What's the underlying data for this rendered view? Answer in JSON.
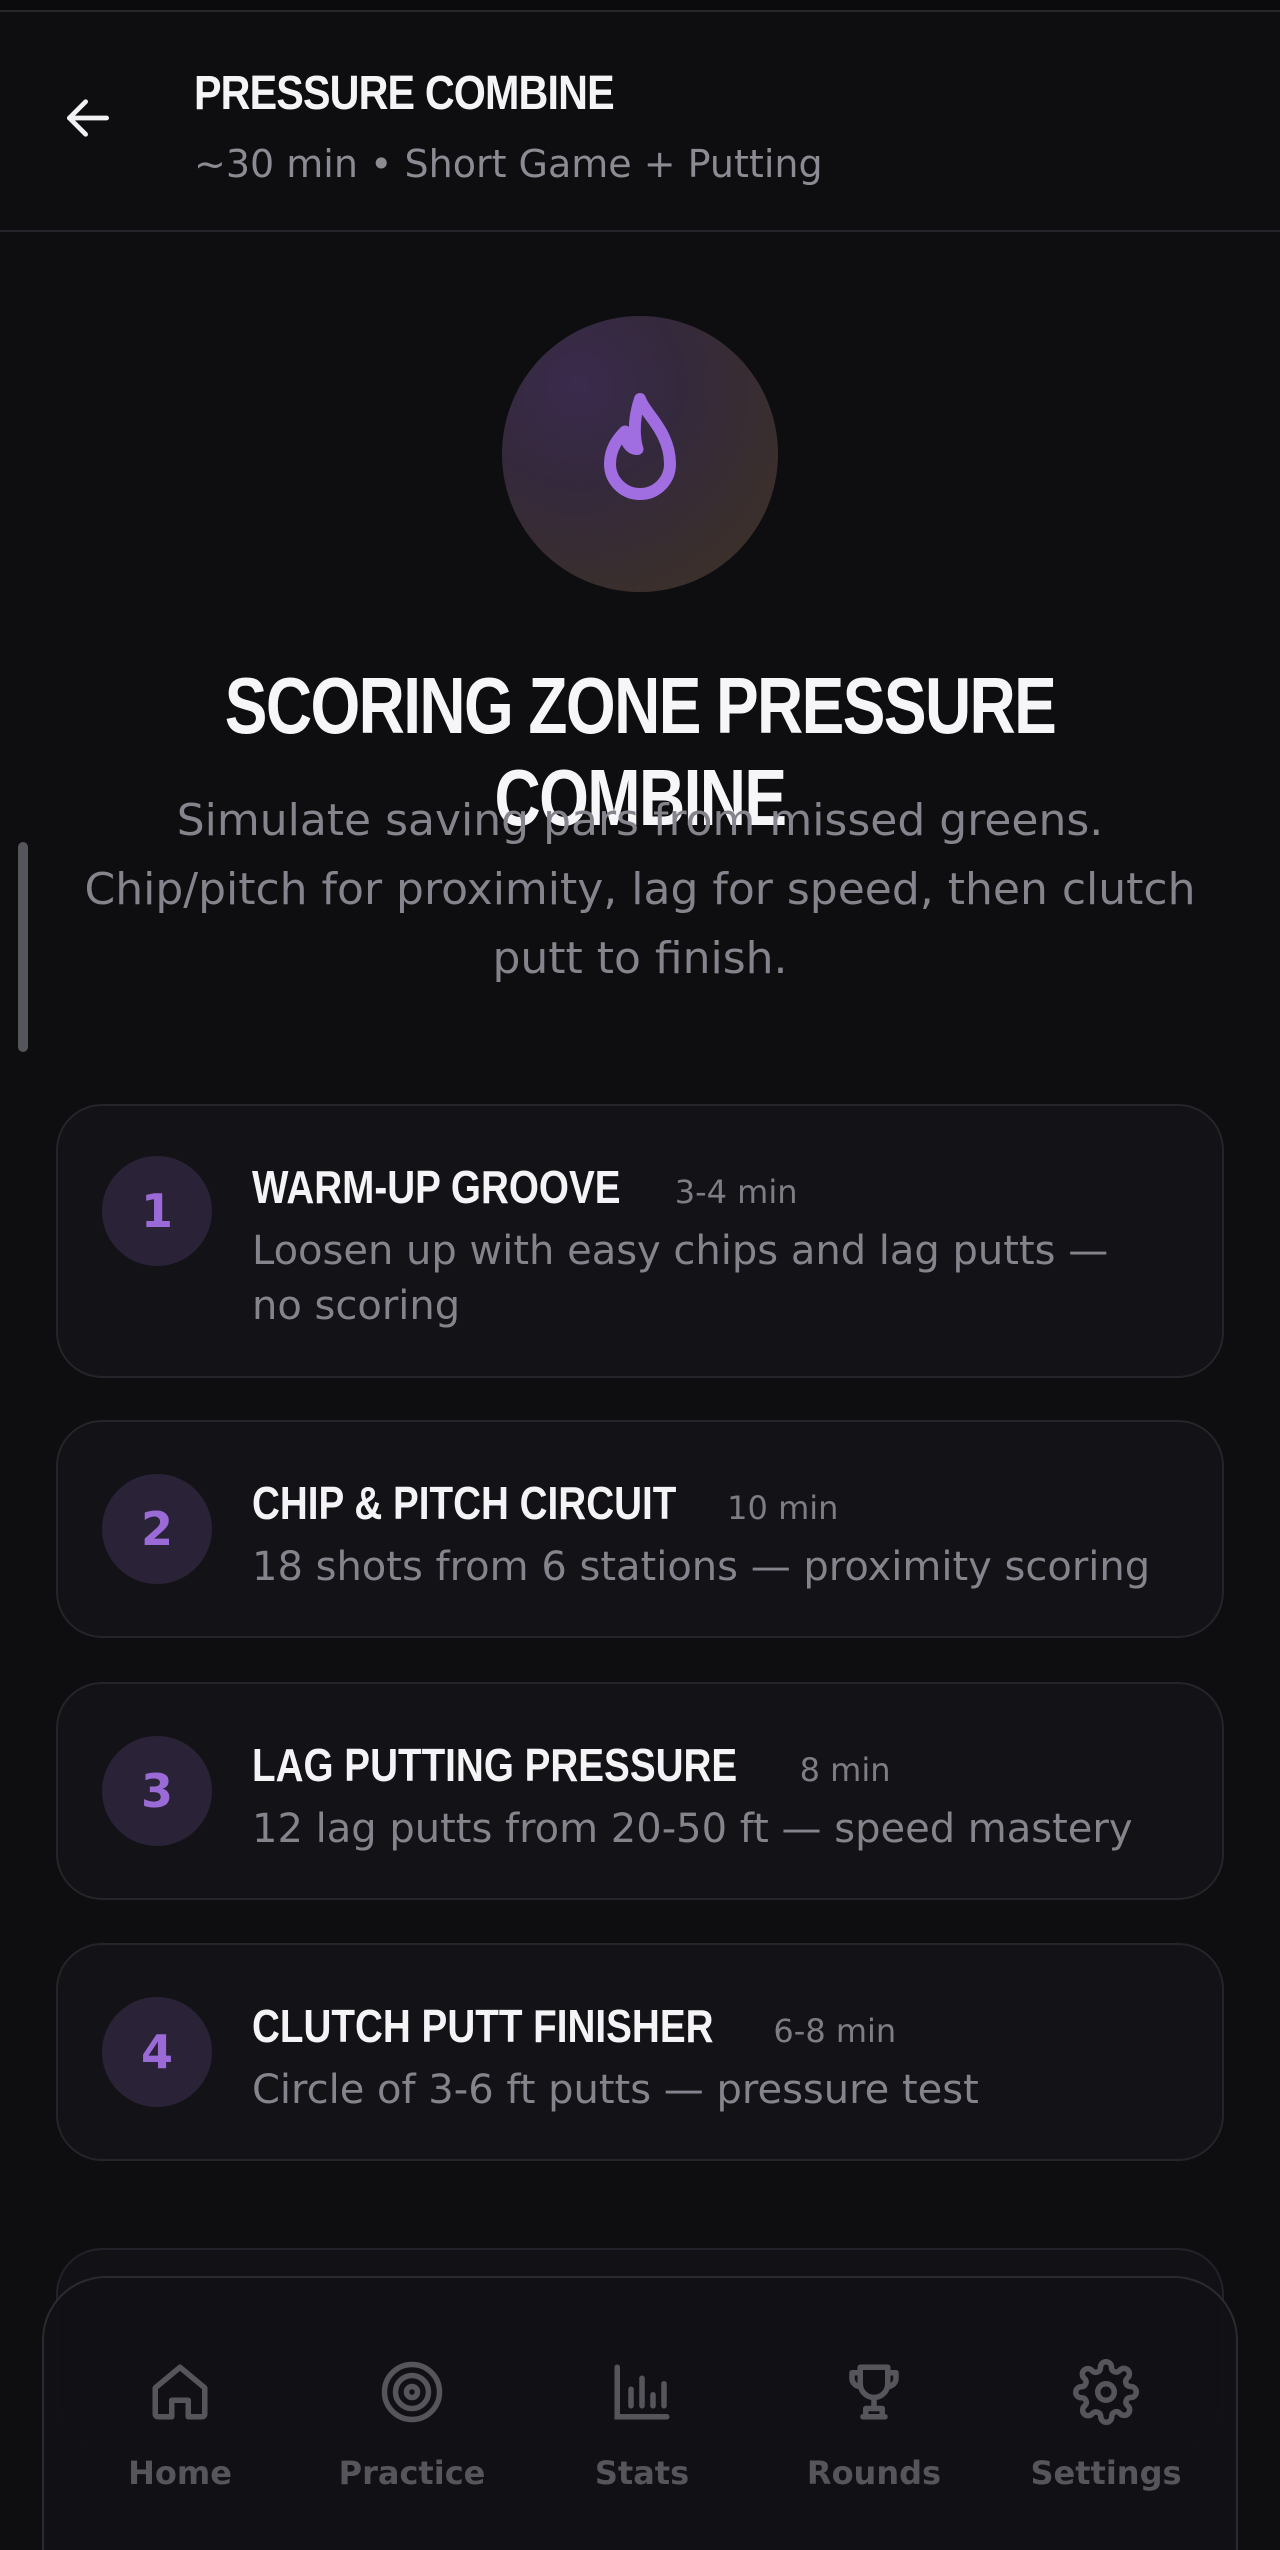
{
  "header": {
    "title": "PRESSURE COMBINE",
    "subtitle": "~30 min • Short Game + Putting",
    "back_icon": "arrow-left-icon"
  },
  "hero": {
    "icon": "flame-icon",
    "title": "SCORING ZONE PRESSURE COMBINE",
    "description": "Simulate saving pars from missed greens. Chip/pitch for proximity, lag for speed, then clutch putt to finish."
  },
  "steps": [
    {
      "number": "1",
      "title": "WARM-UP GROOVE",
      "duration": "3-4 min",
      "description": "Loosen up with easy chips and lag putts — no scoring"
    },
    {
      "number": "2",
      "title": "CHIP & PITCH CIRCUIT",
      "duration": "10 min",
      "description": "18 shots from 6 stations — proximity scoring"
    },
    {
      "number": "3",
      "title": "LAG PUTTING PRESSURE",
      "duration": "8 min",
      "description": "12 lag putts from 20-50 ft — speed mastery"
    },
    {
      "number": "4",
      "title": "CLUTCH PUTT FINISHER",
      "duration": "6-8 min",
      "description": "Circle of 3-6 ft putts — pressure test"
    }
  ],
  "nav": [
    {
      "label": "Home",
      "icon": "home-icon"
    },
    {
      "label": "Practice",
      "icon": "target-icon"
    },
    {
      "label": "Stats",
      "icon": "bar-chart-icon"
    },
    {
      "label": "Rounds",
      "icon": "trophy-icon"
    },
    {
      "label": "Settings",
      "icon": "gear-icon"
    }
  ],
  "colors": {
    "background": "#0e0e11",
    "accent": "#9a6ad6",
    "text_primary": "#f4f4f6",
    "text_secondary": "#85848c",
    "nav_inactive": "#56555c"
  }
}
